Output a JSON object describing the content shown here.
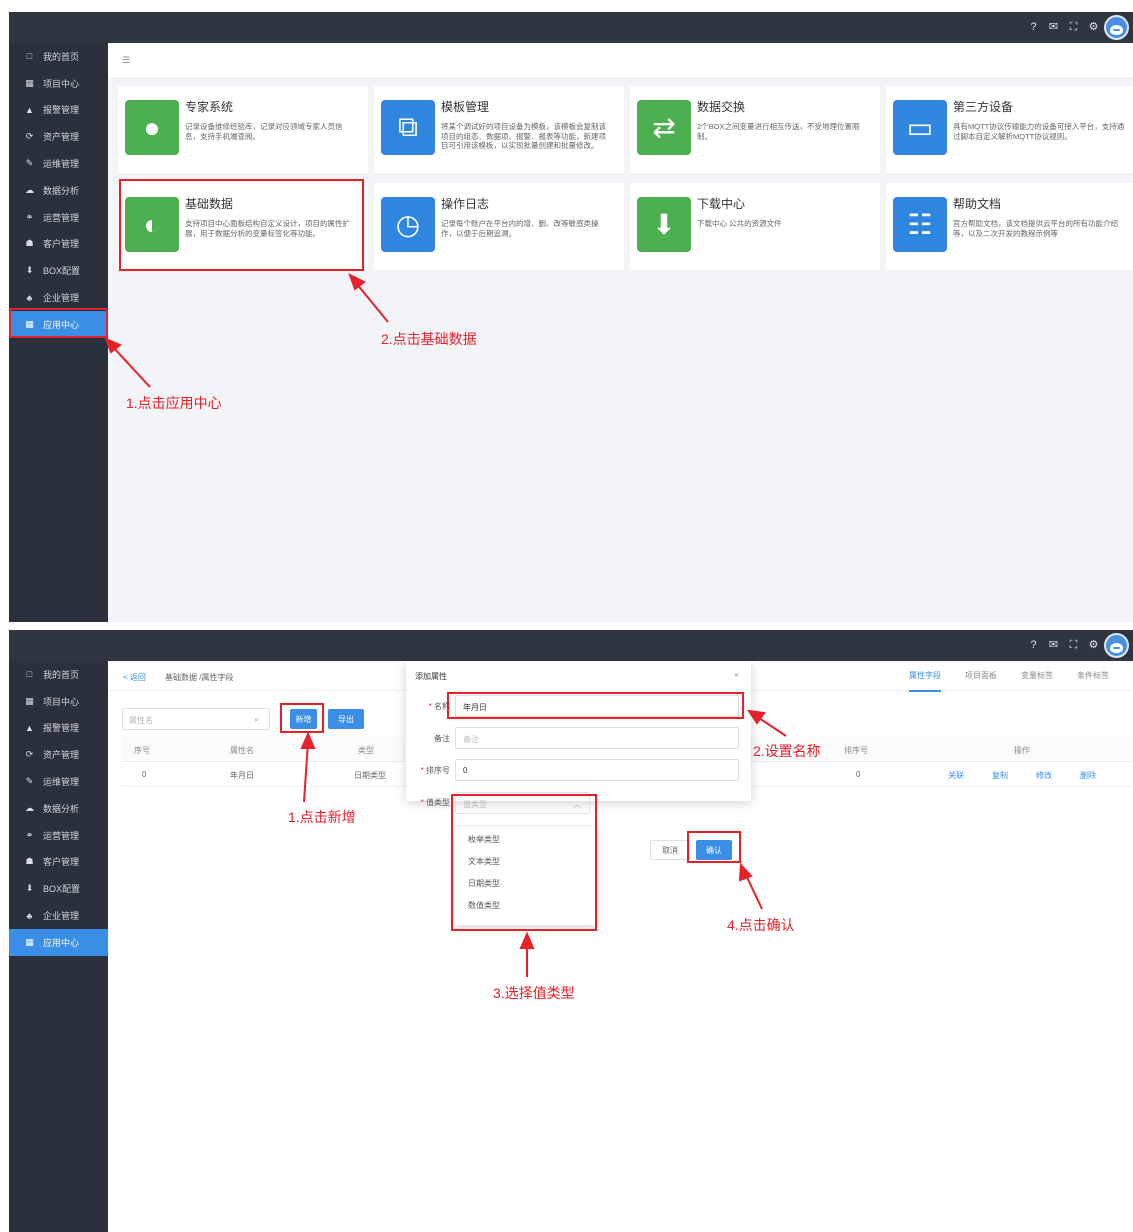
{
  "top_icons": [
    "?",
    "✉",
    "⛶",
    "⚙"
  ],
  "sidebar": {
    "items": [
      {
        "label": "我的首页",
        "icon": "□"
      },
      {
        "label": "项目中心",
        "icon": "▦"
      },
      {
        "label": "报警管理",
        "icon": "▲"
      },
      {
        "label": "资产管理",
        "icon": "⟳"
      },
      {
        "label": "运维管理",
        "icon": "✎"
      },
      {
        "label": "数据分析",
        "icon": "☁"
      },
      {
        "label": "运营管理",
        "icon": "⚭"
      },
      {
        "label": "客户管理",
        "icon": "☗"
      },
      {
        "label": "BOX配置",
        "icon": "⬇"
      },
      {
        "label": "企业管理",
        "icon": "♣"
      },
      {
        "label": "应用中心",
        "icon": "▦"
      }
    ],
    "active_index": 10
  },
  "app_center": {
    "breadcrumb_icon": "☰",
    "cards": [
      {
        "title": "专家系统",
        "desc": "记录设备维修经验库，记录对应领域专家人员信息，支持手机端查阅。",
        "icon": "user-icon",
        "glyph": "●",
        "color": "#4caf50"
      },
      {
        "title": "模板管理",
        "desc": "将某个调试好的项目设备为模板，该模板会复制该项目的组态、数据项、报警、报表等功能，新建项目可引用该模板，以实现批量创建和批量修改。",
        "icon": "copy-icon",
        "glyph": "⧉",
        "color": "#2e86de"
      },
      {
        "title": "数据交换",
        "desc": "2个BOX之间变量进行相互传送，不受地理位置限制。",
        "icon": "exchange-icon",
        "glyph": "⇄",
        "color": "#4caf50"
      },
      {
        "title": "第三方设备",
        "desc": "具有MQTT协议传输能力的设备可接入平台，支持通过脚本自定义解析MQTT协议规则。",
        "icon": "device-icon",
        "glyph": "▭",
        "color": "#2e86de"
      },
      {
        "title": "基础数据",
        "desc": "支持项目中心面板结构自定义设计，项目的属性扩展，用于数据分析的变量标签化等功能。",
        "icon": "contrast-icon",
        "glyph": "◐",
        "color": "#4caf50"
      },
      {
        "title": "操作日志",
        "desc": "记录每个账户在平台内的增、删、改等敏感类操作，以便于后期追溯。",
        "icon": "clock-icon",
        "glyph": "◷",
        "color": "#2e86de"
      },
      {
        "title": "下载中心",
        "desc": "下载中心 公共的资源文件",
        "icon": "download-icon",
        "glyph": "⬇",
        "color": "#4caf50"
      },
      {
        "title": "帮助文档",
        "desc": "官方帮助文档，该文档提供云平台的所有功能介绍等，以及二次开发的教程示例等",
        "icon": "document-icon",
        "glyph": "☷",
        "color": "#2e86de"
      }
    ]
  },
  "annotations1": {
    "step1": "1.点击应用中心",
    "step2": "2.点击基础数据"
  },
  "attr_page": {
    "back": "< 返回",
    "breadcrumb": "基础数据 /属性字段",
    "tabs": [
      "属性字段",
      "项目面板",
      "变量标签",
      "条件标签"
    ],
    "search_placeholder": "属性名",
    "btn_add": "新增",
    "btn_export": "导出",
    "columns": [
      "序号",
      "属性名",
      "类型",
      "排序号",
      "操作"
    ],
    "rows": [
      {
        "index": "0",
        "name": "年月日",
        "type": "日期类型",
        "sort": "0"
      }
    ],
    "actions": [
      "关联",
      "复制",
      "修改",
      "删除"
    ]
  },
  "dialog": {
    "title": "添加属性",
    "close": "×",
    "name_label": "名称",
    "name_value": "年月日",
    "remark_label": "备注",
    "remark_placeholder": "备注",
    "sort_label": "排序号",
    "sort_value": "0",
    "type_label": "值类型",
    "type_placeholder": "值类型",
    "options": [
      "枚举类型",
      "文本类型",
      "日期类型",
      "数值类型"
    ],
    "cancel": "取消",
    "confirm": "确认"
  },
  "annotations2": {
    "step1": "1.点击新增",
    "step2": "2.设置名称",
    "step3": "3.选择值类型",
    "step4": "4.点击确认"
  }
}
